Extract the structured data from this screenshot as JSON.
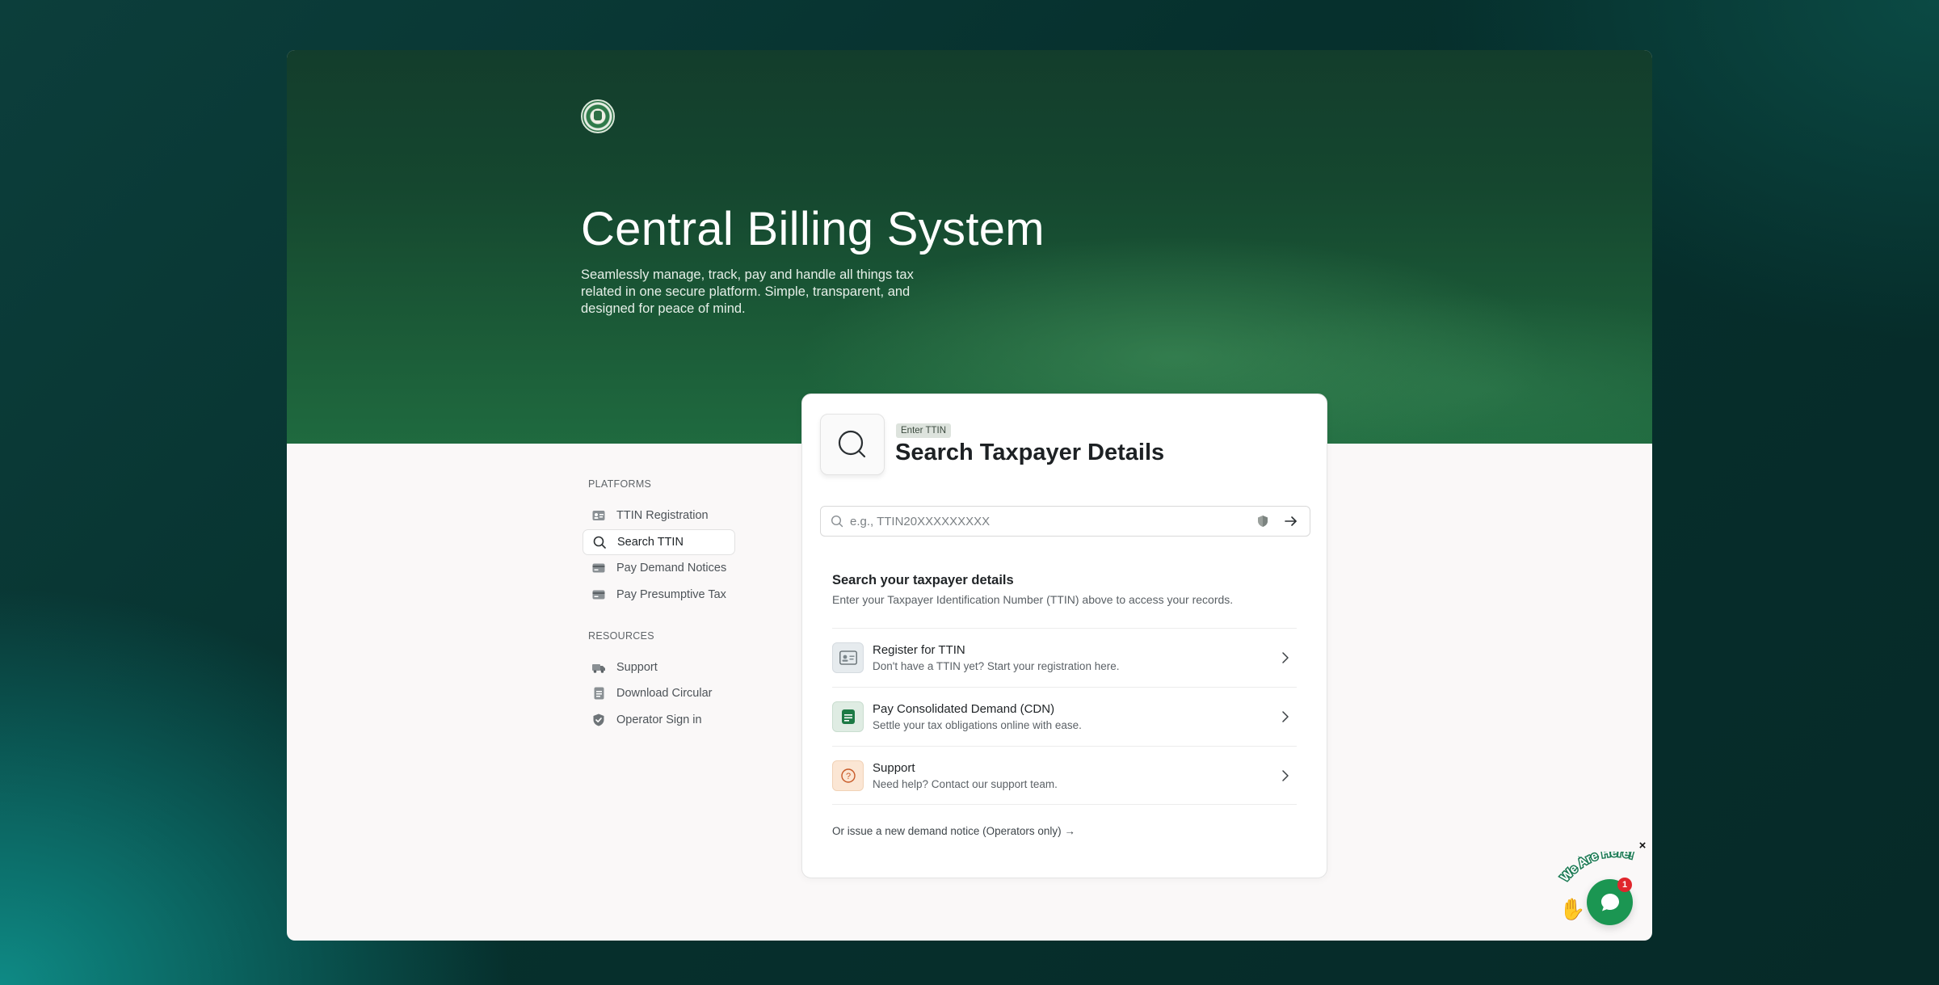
{
  "app": {
    "title": "Central Billing System",
    "subtitle": "Seamlessly manage, track, pay and handle all things tax related in one secure platform. Simple, transparent, and designed for peace of mind."
  },
  "sidebar": {
    "platforms_heading": "PLATFORMS",
    "platforms": [
      {
        "label": "TTIN Registration",
        "icon": "id-card-icon"
      },
      {
        "label": "Search TTIN",
        "icon": "search-icon",
        "active": true
      },
      {
        "label": "Pay Demand Notices",
        "icon": "credit-card-icon"
      },
      {
        "label": "Pay Presumptive Tax",
        "icon": "credit-card-icon"
      }
    ],
    "resources_heading": "RESOURCES",
    "resources": [
      {
        "label": "Support",
        "icon": "truck-icon"
      },
      {
        "label": "Download Circular",
        "icon": "document-icon"
      },
      {
        "label": "Operator Sign in",
        "icon": "shield-check-icon"
      }
    ]
  },
  "search_card": {
    "chip": "Enter TTIN",
    "title": "Search Taxpayer Details",
    "input_placeholder": "e.g., TTIN20XXXXXXXXX",
    "input_value": "",
    "section_title": "Search your taxpayer details",
    "section_sub": "Enter your Taxpayer Identification Number (TTIN) above to access your records.",
    "options": [
      {
        "title": "Register for TTIN",
        "sub": "Don't have a TTIN yet? Start your registration here.",
        "icon": "id-card-icon"
      },
      {
        "title": "Pay Consolidated Demand (CDN)",
        "sub": "Settle your tax obligations online with ease.",
        "icon": "document-icon"
      },
      {
        "title": "Support",
        "sub": "Need help? Contact our support team.",
        "icon": "question-icon"
      }
    ],
    "footer_link": "Or issue a new demand notice (Operators only) →"
  },
  "chat": {
    "label": "We Are Here!",
    "badge": "1",
    "close": "×"
  },
  "colors": {
    "brand_green": "#1b9652",
    "hero_dark": "#133d2c",
    "badge_red": "#e0262c"
  }
}
